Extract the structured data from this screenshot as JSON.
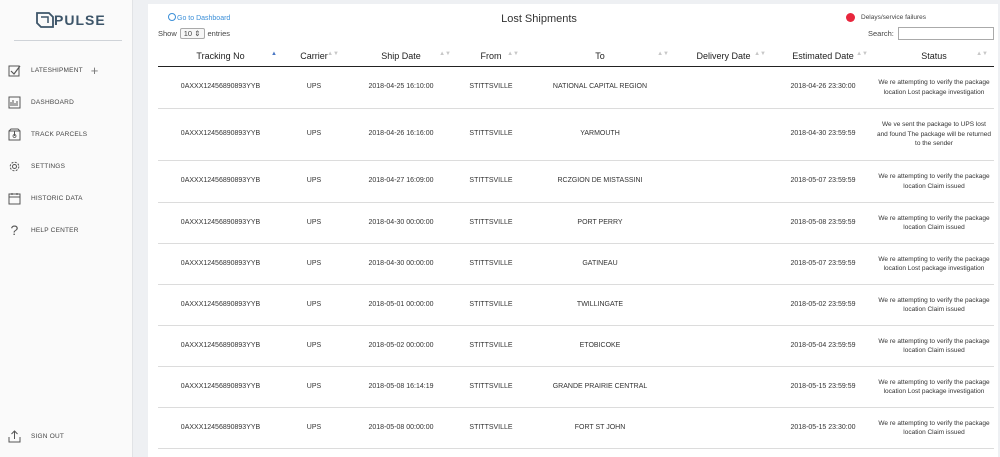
{
  "app": {
    "logo_text": "PULSE"
  },
  "sidebar": {
    "items": [
      {
        "label": "LATESHIPMENT",
        "icon": "checkbox-icon"
      },
      {
        "label": "DASHBOARD",
        "icon": "dashboard-icon"
      },
      {
        "label": "TRACK PARCELS",
        "icon": "package-icon"
      },
      {
        "label": "SETTINGS",
        "icon": "gear-icon"
      },
      {
        "label": "HISTORIC DATA",
        "icon": "calendar-icon"
      },
      {
        "label": "HELP CENTER",
        "icon": "question-icon"
      }
    ],
    "plus": "+",
    "signout": "SIGN OUT"
  },
  "header": {
    "goto_dashboard": "Go to Dashboard",
    "title": "Lost Shipments",
    "show_label": "Show",
    "entries_value": "10",
    "entries_label": "entries",
    "legend_label": "Delays/service failures",
    "legend_color": "#e8263d",
    "search_label": "Search:"
  },
  "table": {
    "columns": [
      "Tracking No",
      "Carrier",
      "Ship Date",
      "From",
      "To",
      "Delivery Date",
      "Estimated Date",
      "Status"
    ],
    "rows": [
      {
        "tracking": "0AXXX12456890893YYB",
        "carrier": "UPS",
        "ship": "2018-04-25 16:10:00",
        "from": "STITTSVILLE",
        "to": "NATIONAL CAPITAL REGION",
        "delivery": "",
        "estimated": "2018-04-26 23:30:00",
        "status": "We re attempting to verify the package location Lost package investigation"
      },
      {
        "tracking": "0AXXX12456890893YYB",
        "carrier": "UPS",
        "ship": "2018-04-26 16:16:00",
        "from": "STITTSVILLE",
        "to": "YARMOUTH",
        "delivery": "",
        "estimated": "2018-04-30 23:59:59",
        "status": "We ve sent the package to UPS lost and found The package will be returned to the sender"
      },
      {
        "tracking": "0AXXX12456890893YYB",
        "carrier": "UPS",
        "ship": "2018-04-27 16:09:00",
        "from": "STITTSVILLE",
        "to": "RCZGION DE MISTASSINI",
        "delivery": "",
        "estimated": "2018-05-07 23:59:59",
        "status": "We re attempting to verify the package location Claim issued"
      },
      {
        "tracking": "0AXXX12456890893YYB",
        "carrier": "UPS",
        "ship": "2018-04-30 00:00:00",
        "from": "STITTSVILLE",
        "to": "PORT PERRY",
        "delivery": "",
        "estimated": "2018-05-08 23:59:59",
        "status": "We re attempting to verify the package location Claim issued"
      },
      {
        "tracking": "0AXXX12456890893YYB",
        "carrier": "UPS",
        "ship": "2018-04-30 00:00:00",
        "from": "STITTSVILLE",
        "to": "GATINEAU",
        "delivery": "",
        "estimated": "2018-05-07 23:59:59",
        "status": "We re attempting to verify the package location Lost package investigation"
      },
      {
        "tracking": "0AXXX12456890893YYB",
        "carrier": "UPS",
        "ship": "2018-05-01 00:00:00",
        "from": "STITTSVILLE",
        "to": "TWILLINGATE",
        "delivery": "",
        "estimated": "2018-05-02 23:59:59",
        "status": "We re attempting to verify the package location Claim issued"
      },
      {
        "tracking": "0AXXX12456890893YYB",
        "carrier": "UPS",
        "ship": "2018-05-02 00:00:00",
        "from": "STITTSVILLE",
        "to": "ETOBICOKE",
        "delivery": "",
        "estimated": "2018-05-04 23:59:59",
        "status": "We re attempting to verify the package location Claim issued"
      },
      {
        "tracking": "0AXXX12456890893YYB",
        "carrier": "UPS",
        "ship": "2018-05-08 16:14:19",
        "from": "STITTSVILLE",
        "to": "GRANDE PRAIRIE CENTRAL",
        "delivery": "",
        "estimated": "2018-05-15 23:59:59",
        "status": "We re attempting to verify the package location Lost package investigation"
      },
      {
        "tracking": "0AXXX12456890893YYB",
        "carrier": "UPS",
        "ship": "2018-05-08 00:00:00",
        "from": "STITTSVILLE",
        "to": "FORT ST JOHN",
        "delivery": "",
        "estimated": "2018-05-15 23:30:00",
        "status": "We re attempting to verify the package location Claim issued"
      }
    ]
  }
}
